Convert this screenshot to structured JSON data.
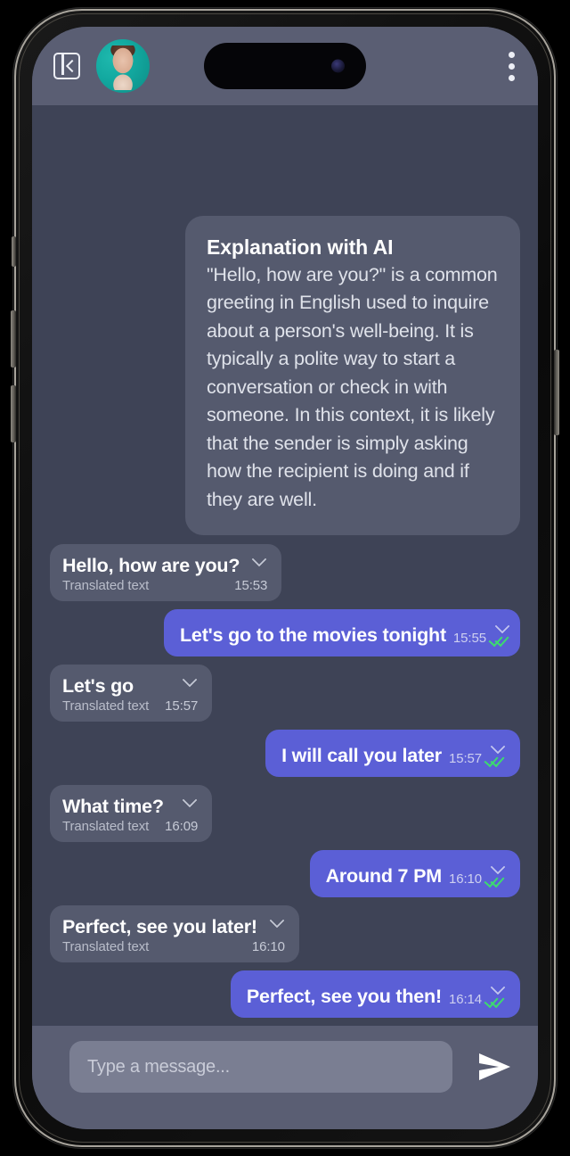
{
  "appbar": {
    "collapse_icon": "panel-collapse-left-icon",
    "avatar_alt": "contact-avatar",
    "menu_icon": "overflow-menu-icon"
  },
  "ai_card": {
    "title": "Explanation with AI",
    "body": "\"Hello, how are you?\" is a common greeting in English used to inquire about a person's well-being. It is typically a polite way to start a conversation or check in with someone. In this context, it is likely that the sender is simply asking how the recipient is doing and if they are well."
  },
  "messages": [
    {
      "direction": "in",
      "text": "Hello, how are you?",
      "sublabel": "Translated text",
      "time": "15:53",
      "chevron": "chevron-down-icon"
    },
    {
      "direction": "out",
      "text": "Let's go to the movies tonight",
      "time": "15:55",
      "chevron": "chevron-down-icon",
      "status": "read-double-check-icon"
    },
    {
      "direction": "in",
      "text": "Let's go",
      "sublabel": "Translated text",
      "time": "15:57",
      "chevron": "chevron-down-icon"
    },
    {
      "direction": "out",
      "text": "I will call you later",
      "time": "15:57",
      "chevron": "chevron-down-icon",
      "status": "read-double-check-icon"
    },
    {
      "direction": "in",
      "text": "What time?",
      "sublabel": "Translated text",
      "time": "16:09",
      "chevron": "chevron-down-icon"
    },
    {
      "direction": "out",
      "text": "Around 7 PM",
      "time": "16:10",
      "chevron": "chevron-down-icon",
      "status": "read-double-check-icon"
    },
    {
      "direction": "in",
      "text": "Perfect, see you later!",
      "sublabel": "Translated text",
      "time": "16:10",
      "chevron": "chevron-down-icon"
    },
    {
      "direction": "out",
      "text": "Perfect, see you then!",
      "time": "16:14",
      "chevron": "chevron-down-icon",
      "status": "read-double-check-icon"
    }
  ],
  "composer": {
    "placeholder": "Type a message...",
    "value": "",
    "send_icon": "send-paper-plane-icon"
  },
  "colors": {
    "chat_background": "#3e4356",
    "appbar": "#5a5e73",
    "incoming_bubble": "#555a6e",
    "outgoing_bubble": "#5b5fd6",
    "ai_card": "#555a6e",
    "input_pill": "#7a7e92",
    "read_check": "#3ddb6e",
    "avatar_ring": "#12a89f"
  }
}
